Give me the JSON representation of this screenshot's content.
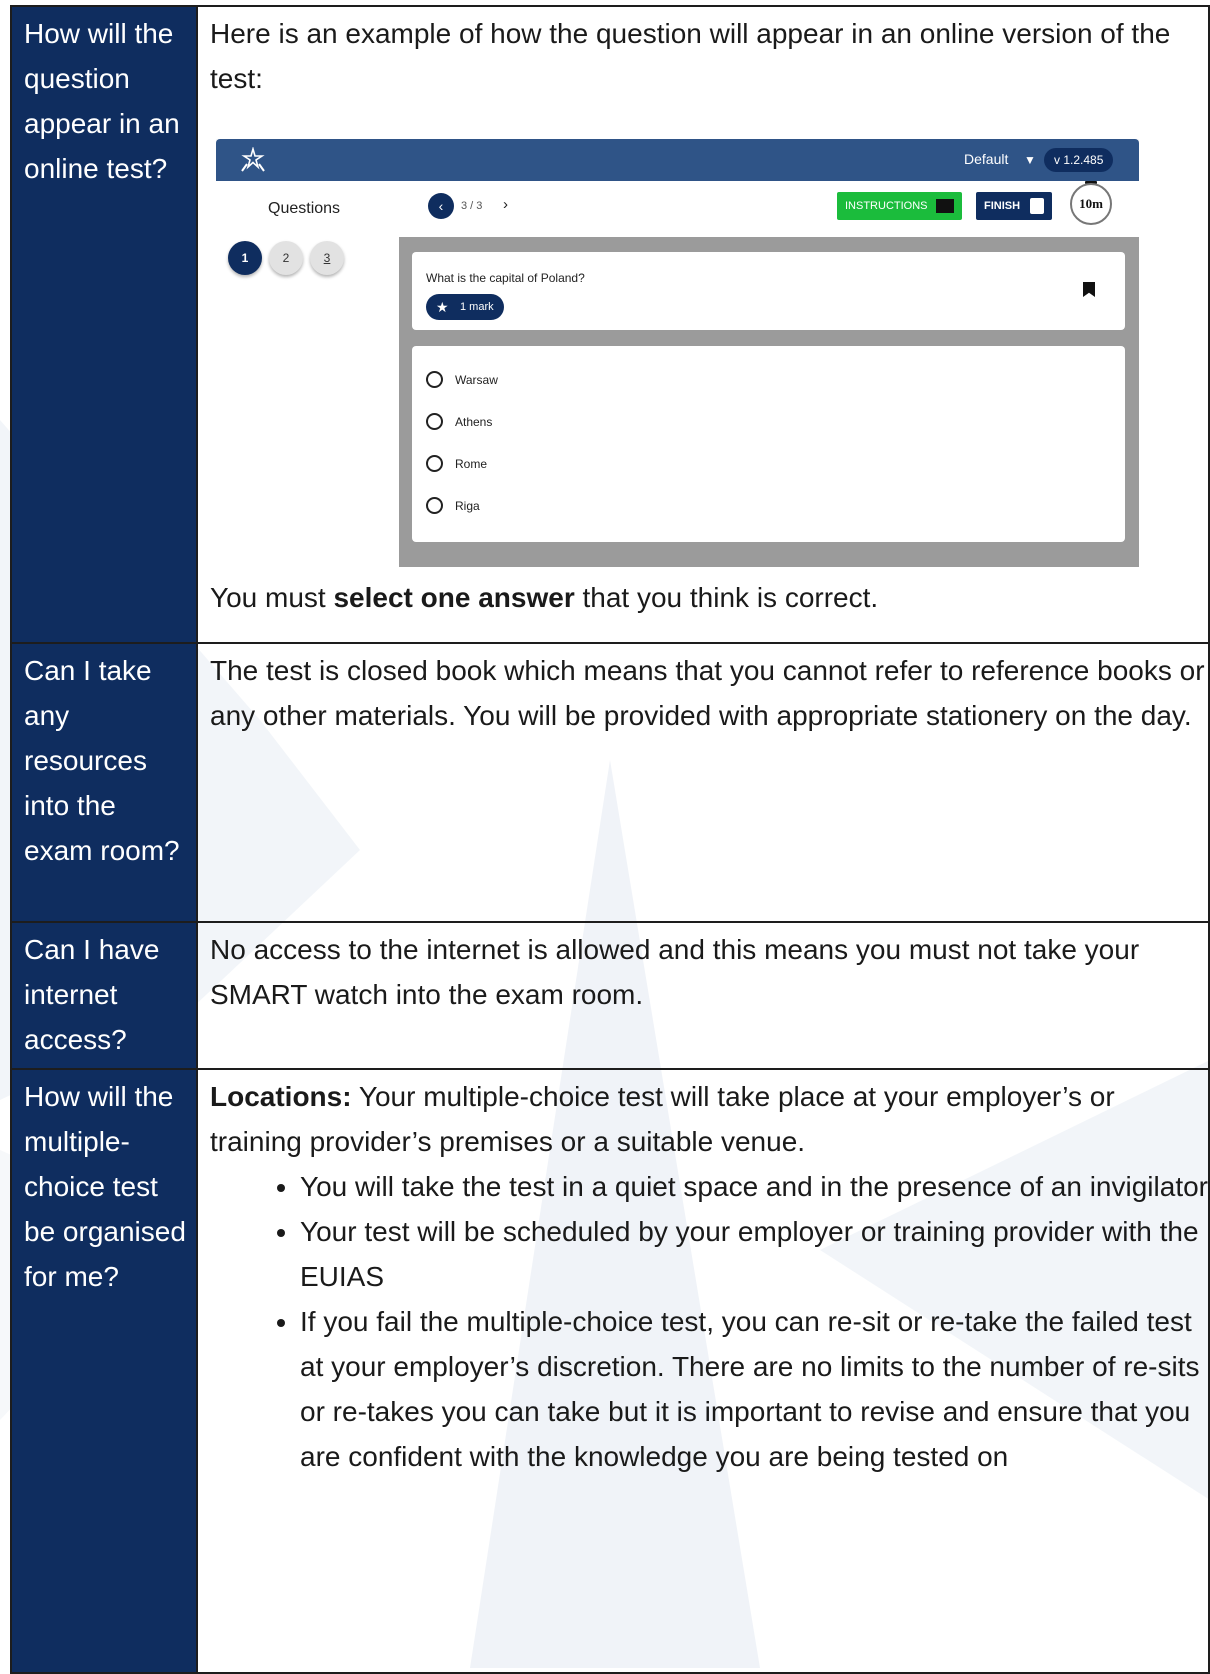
{
  "rows": [
    {
      "question": "How will the question appear in an online test?",
      "intro": "Here is an example of how the question will appear in an online version of the test:",
      "outro_pre": "You must ",
      "outro_bold": "select one answer",
      "outro_post": " that you think is correct."
    },
    {
      "question": "Can I take any resources into the exam room?",
      "answer": "The test is closed book which means that you cannot refer to reference books or any other materials. You will be provided with appropriate stationery on the day."
    },
    {
      "question": "Can I have internet access?",
      "answer": "No access to the internet is allowed and this means you must not take your SMART watch into the exam room."
    },
    {
      "question": "How will the multiple-choice test be organised for me?",
      "lead_bold": "Locations:",
      "lead_text": " Your multiple-choice test will take place at your employer’s or training provider’s premises or a suitable venue.",
      "bullets": [
        "You will take the test in a quiet space and in the presence of an invigilator",
        "Your test will be scheduled by your employer or training provider with the EUIAS",
        "If you fail the multiple-choice test, you can re-sit or re-take the failed test at your employer’s discretion. There are no limits to the number of re-sits or re-takes you can take but it is important to revise and ensure that you are confident with the knowledge you are being tested on"
      ]
    }
  ],
  "app": {
    "profile": "Default",
    "version": "v 1.2.485",
    "questions_heading": "Questions",
    "pills": [
      "1",
      "2",
      "3"
    ],
    "nav_count": "3 / 3",
    "instructions_label": "INSTRUCTIONS",
    "finish_label": "FINISH",
    "timer": "10m",
    "question_text": "What is the capital of Poland?",
    "mark_label": "1 mark",
    "options": [
      "Warsaw",
      "Athens",
      "Rome",
      "Riga"
    ],
    "colors": {
      "header": "#2f5487",
      "navy": "#0f2d5f",
      "instructions": "#1bbc3c"
    }
  }
}
